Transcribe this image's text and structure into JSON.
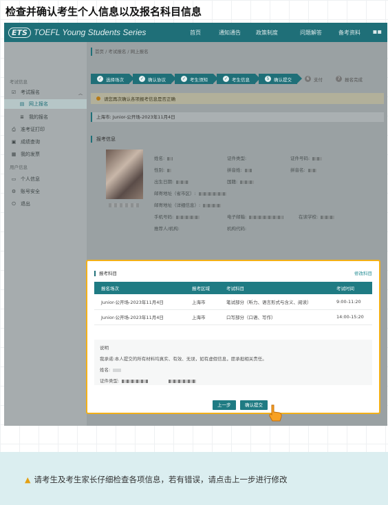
{
  "page_heading": "检查并确认考生个人信息以及报名科目信息",
  "topbar": {
    "logo_mark": "ETS",
    "brand": "TOEFL Young Students Series",
    "nav": [
      "首页",
      "通知通告",
      "政策制度",
      "问题解答",
      "备考资料"
    ],
    "menu_icon": "menu-icon"
  },
  "sidebar": {
    "group_exam": "考试信息",
    "exam_signup": "考试报名",
    "online_signup": "网上报名",
    "my_signup": "我的报名",
    "print_ticket": "准考证打印",
    "score_query": "成绩查询",
    "my_invoice": "我的发票",
    "group_user": "用户信息",
    "personal_info": "个人信息",
    "account_security": "账号安全",
    "logout": "退出"
  },
  "breadcrumb": "首页 / 考试报名 / 网上报名",
  "steps": [
    "选择场次",
    "确认协议",
    "考生须知",
    "考生信息",
    "确认提交",
    "支付",
    "报名完成"
  ],
  "notice": "请您再次确认各项报考信息是否正确",
  "location": "上海市:   Junior-公开场-2023年11月4日",
  "section_title": "报考信息",
  "form_fields": {
    "name": "姓名:",
    "id_type": "证件类型:",
    "id_number": "证件号码:",
    "gender": "性别:",
    "pinyin_last": "拼音姓:",
    "pinyin_first": "拼音名:",
    "birth": "出生日期:",
    "nationality": "国籍:",
    "mail_city": "邮寄地址（省市区）:",
    "mail_detail": "邮寄地址（详细信息）:",
    "phone": "手机号码:",
    "email": "电子邮箱:",
    "school": "在读学校:",
    "referrer": "推荐人/机构:",
    "org_code": "机构代码:"
  },
  "card": {
    "title": "报考科目",
    "edit": "修改科目",
    "columns": [
      "报名场次",
      "报考区域",
      "考试科目",
      "考试时间"
    ],
    "rows": [
      [
        "Junior-公开场-2023年11月4日",
        "上海市",
        "笔试部分（听力、语言形式与含义、阅读）",
        "9:00-11:20"
      ],
      [
        "Junior-公开场-2023年11月4日",
        "上海市",
        "口写部分（口语、写作）",
        "14:00-15:20"
      ]
    ],
    "desc_title": "说明",
    "desc_text": "我承诺:本人提交的所有材料均真实、有效、无误，如有虚假信息，愿承担相关责任。",
    "desc_name": "姓名:",
    "desc_id_type": "证件类型:",
    "prev_button": "上一步",
    "confirm_button": "确认提交"
  },
  "bottom_warning": "请考生及考生家长仔细检查各项信息，若有错误，请点击上一步进行修改"
}
